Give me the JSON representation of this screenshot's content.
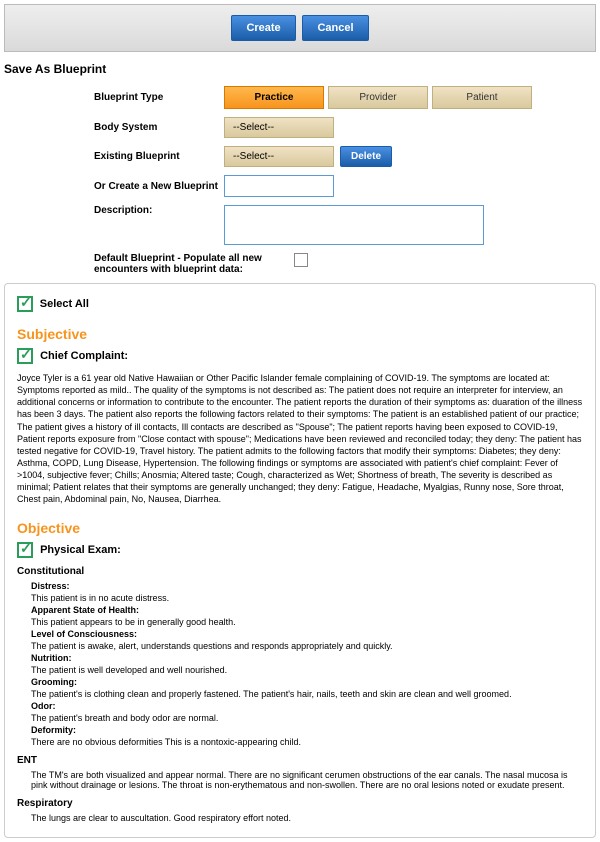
{
  "buttons": {
    "create": "Create",
    "cancel": "Cancel",
    "delete": "Delete"
  },
  "title": "Save As Blueprint",
  "form": {
    "blueprint_type_label": "Blueprint Type",
    "types": {
      "practice": "Practice",
      "provider": "Provider",
      "patient": "Patient"
    },
    "body_system_label": "Body System",
    "body_system_value": "--Select--",
    "existing_label": "Existing Blueprint",
    "existing_value": "--Select--",
    "or_create_label": "Or Create a New Blueprint",
    "description_label": "Description:",
    "default_label": "Default Blueprint - Populate all new encounters with blueprint data:"
  },
  "select_all": "Select All",
  "subjective": {
    "heading": "Subjective",
    "cc_label": "Chief Complaint:",
    "cc_text": "Joyce Tyler is a 61 year old Native Hawaiian or Other Pacific Islander female complaining of COVID-19. The symptoms are located at: Symptoms reported as mild.. The quality of the symptoms is not described as: The patient does not require an interpreter for interview, an additional concerns or information to contribute to the encounter. The patient reports the duration of their symptoms as: duaration of the illness has been 3 days. The patient also reports the following factors related to their symptoms: The patient is an established patient of our practice; The patient gives a history of ill contacts, Ill contacts are described as \"Spouse\"; The patient reports having been exposed to COVID-19, Patient reports exposure from \"Close contact with spouse\"; Medications have been reviewed and reconciled today; they deny: The patient has tested negative for COVID-19, Travel history. The patient admits to the following factors that modify their symptoms: Diabetes; they deny: Asthma, COPD, Lung Disease, Hypertension. The following findings or symptoms are associated with patient's chief complaint: Fever of >1004, subjective fever; Chills; Anosmia; Altered taste; Cough, characterized as Wet; Shortness of breath, The severity is described as minimal; Patient relates that their symptoms are generally unchanged; they deny: Fatigue, Headache, Myalgias, Runny nose, Sore throat, Chest pain, Abdominal pain, No, Nausea, Diarrhea."
  },
  "objective": {
    "heading": "Objective",
    "pe_label": "Physical Exam:",
    "constitutional": {
      "heading": "Constitutional",
      "distress_label": "Distress:",
      "distress_text": "This patient is in no acute distress.",
      "apparent_label": "Apparent State of Health:",
      "apparent_text": "This patient appears to be in generally good health.",
      "loc_label": "Level of Consciousness:",
      "loc_text": "The patient is awake, alert, understands questions and responds appropriately and quickly.",
      "nutrition_label": "Nutrition:",
      "nutrition_text": "The patient is well developed and well nourished.",
      "grooming_label": "Grooming:",
      "grooming_text": "The patient's is clothing clean and properly fastened. The patient's hair, nails, teeth and skin are clean and well groomed.",
      "odor_label": "Odor:",
      "odor_text": "The patient's breath and body odor are normal.",
      "deformity_label": "Deformity:",
      "deformity_text": "There are no obvious deformities This is a nontoxic-appearing child."
    },
    "ent": {
      "heading": "ENT",
      "text": "The TM's are both visualized and appear normal. There are no significant cerumen obstructions of the ear canals. The nasal mucosa is pink without drainage or lesions. The throat is non-erythematous and non-swollen. There are no oral lesions noted or exudate present."
    },
    "respiratory": {
      "heading": "Respiratory",
      "text": "The lungs are clear to auscultation. Good respiratory effort noted."
    }
  }
}
